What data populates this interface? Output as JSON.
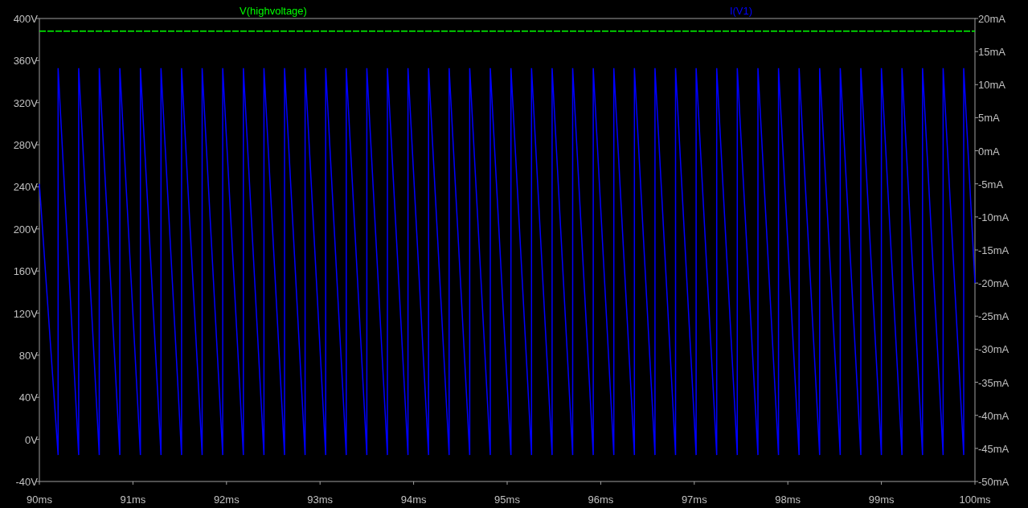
{
  "chart_data": {
    "type": "line",
    "xlim": [
      90,
      100
    ],
    "ylim": [
      -40,
      400
    ],
    "y2lim": [
      -50,
      20
    ],
    "xticks": [
      {
        "value": 90,
        "label": "90ms"
      },
      {
        "value": 91,
        "label": "91ms"
      },
      {
        "value": 92,
        "label": "92ms"
      },
      {
        "value": 93,
        "label": "93ms"
      },
      {
        "value": 94,
        "label": "94ms"
      },
      {
        "value": 95,
        "label": "95ms"
      },
      {
        "value": 96,
        "label": "96ms"
      },
      {
        "value": 97,
        "label": "97ms"
      },
      {
        "value": 98,
        "label": "98ms"
      },
      {
        "value": 99,
        "label": "99ms"
      },
      {
        "value": 100,
        "label": "100ms"
      }
    ],
    "yticks": [
      {
        "value": 400,
        "label": "400V"
      },
      {
        "value": 360,
        "label": "360V"
      },
      {
        "value": 320,
        "label": "320V"
      },
      {
        "value": 280,
        "label": "280V"
      },
      {
        "value": 240,
        "label": "240V"
      },
      {
        "value": 200,
        "label": "200V"
      },
      {
        "value": 160,
        "label": "160V"
      },
      {
        "value": 120,
        "label": "120V"
      },
      {
        "value": 80,
        "label": "80V"
      },
      {
        "value": 40,
        "label": "40V"
      },
      {
        "value": 0,
        "label": "0V"
      },
      {
        "value": -40,
        "label": "-40V"
      }
    ],
    "y2ticks": [
      {
        "value": 20,
        "label": "20mA"
      },
      {
        "value": 15,
        "label": "15mA"
      },
      {
        "value": 10,
        "label": "10mA"
      },
      {
        "value": 5,
        "label": "5mA"
      },
      {
        "value": 0,
        "label": "0mA"
      },
      {
        "value": -5,
        "label": "-5mA"
      },
      {
        "value": -10,
        "label": "-10mA"
      },
      {
        "value": -15,
        "label": "-15mA"
      },
      {
        "value": -20,
        "label": "-20mA"
      },
      {
        "value": -25,
        "label": "-25mA"
      },
      {
        "value": -30,
        "label": "-30mA"
      },
      {
        "value": -35,
        "label": "-35mA"
      },
      {
        "value": -40,
        "label": "-40mA"
      },
      {
        "value": -45,
        "label": "-45mA"
      },
      {
        "value": -50,
        "label": "-50mA"
      }
    ],
    "series": [
      {
        "name": "V(highvoltage)",
        "color": "#00ff00",
        "line_style": "dashed",
        "x": [
          90,
          100
        ],
        "values": [
          388,
          388
        ]
      },
      {
        "name": "I(V1)",
        "color": "#0000ff",
        "axis": "y2",
        "x": [
          90,
          90.2,
          90.2,
          90.42,
          90.42,
          90.64,
          90.64,
          90.86,
          90.86,
          91.08,
          91.08,
          91.3,
          91.3,
          91.52,
          91.52,
          91.74,
          91.74,
          91.96,
          91.96,
          92.18,
          92.18,
          92.4,
          92.4,
          92.62,
          92.62,
          92.84,
          92.84,
          93.06,
          93.06,
          93.28,
          93.28,
          93.5,
          93.5,
          93.72,
          93.72,
          93.94,
          93.94,
          94.16,
          94.16,
          94.38,
          94.38,
          94.6,
          94.6,
          94.82,
          94.82,
          95.04,
          95.04,
          95.26,
          95.26,
          95.48,
          95.48,
          95.7,
          95.7,
          95.92,
          95.92,
          96.14,
          96.14,
          96.36,
          96.36,
          96.58,
          96.58,
          96.8,
          96.8,
          97.02,
          97.02,
          97.24,
          97.24,
          97.46,
          97.46,
          97.68,
          97.68,
          97.9,
          97.9,
          98.12,
          98.12,
          98.34,
          98.34,
          98.56,
          98.56,
          98.78,
          98.78,
          99,
          99,
          99.22,
          99.22,
          99.44,
          99.44,
          99.66,
          99.66,
          99.88,
          99.88,
          100
        ],
        "values": [
          -5,
          -46,
          12.5,
          -46,
          12.5,
          -46,
          12.5,
          -46,
          12.5,
          -46,
          12.5,
          -46,
          12.5,
          -46,
          12.5,
          -46,
          12.5,
          -46,
          12.5,
          -46,
          12.5,
          -46,
          12.5,
          -46,
          12.5,
          -46,
          12.5,
          -46,
          12.5,
          -46,
          12.5,
          -46,
          12.5,
          -46,
          12.5,
          -46,
          12.5,
          -46,
          12.5,
          -46,
          12.5,
          -46,
          12.5,
          -46,
          12.5,
          -46,
          12.5,
          -46,
          12.5,
          -46,
          12.5,
          -46,
          12.5,
          -46,
          12.5,
          -46,
          12.5,
          -46,
          12.5,
          -46,
          12.5,
          -46,
          12.5,
          -46,
          12.5,
          -46,
          12.5,
          -46,
          12.5,
          -46,
          12.5,
          -46,
          12.5,
          -46,
          12.5,
          -46,
          12.5,
          -46,
          12.5,
          -46,
          12.5,
          -46,
          12.5,
          -46,
          12.5,
          -46,
          12.5,
          -46,
          12.5,
          -46,
          12.5,
          -20
        ]
      }
    ]
  }
}
